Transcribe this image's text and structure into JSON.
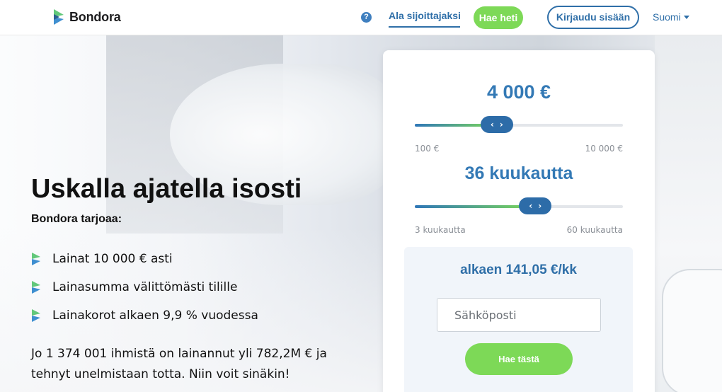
{
  "header": {
    "brand": "Bondora",
    "help_icon": "question-circle-icon",
    "help_glyph": "?",
    "investor_link": "Ala sijoittajaksi",
    "apply_button": "Hae heti",
    "login_button": "Kirjaudu sisään",
    "language": "Suomi"
  },
  "hero": {
    "title": "Uskalla ajatella isosti",
    "subtitle": "Bondora tarjoaa:",
    "bullets": [
      {
        "text": "Lainat 10 000 € asti"
      },
      {
        "text": "Lainasumma välittömästi tilille"
      },
      {
        "text": "Lainakorot alkaen 9,9 % vuodessa"
      }
    ],
    "stats": "Jo 1 374 001 ihmistä on lainannut yli 782,2M € ja tehnyt unelmistaan totta. Niin voit sinäkin!"
  },
  "calculator": {
    "amount": {
      "display": "4 000 €",
      "min_label": "100 €",
      "max_label": "10 000 €",
      "value": 4000,
      "min": 100,
      "max": 10000
    },
    "term": {
      "display": "36 kuukautta",
      "min_label": "3 kuukautta",
      "max_label": "60 kuukautta",
      "value": 36,
      "min": 3,
      "max": 60
    },
    "thumb_left": "‹",
    "thumb_right": "›",
    "monthly": "alkaen 141,05 €/kk",
    "email_placeholder": "Sähköposti",
    "submit": "Hae tästä"
  },
  "colors": {
    "brand_blue": "#3379b5",
    "accent_green": "#7dd957",
    "logo_green": "#62c87a",
    "logo_blue": "#3f8fd0"
  }
}
